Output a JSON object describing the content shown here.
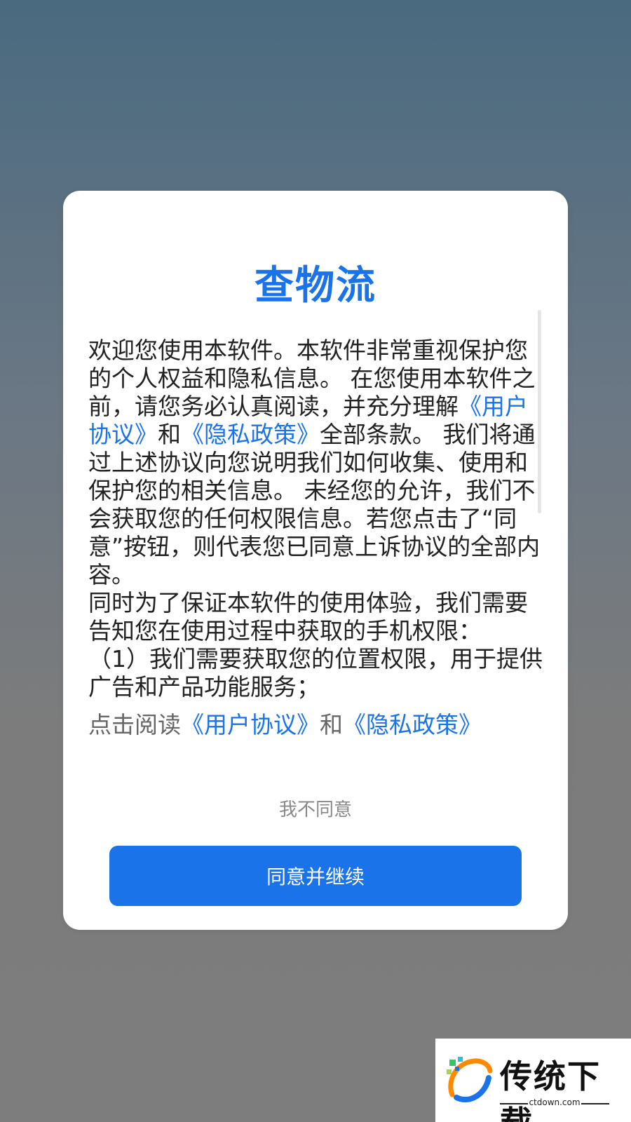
{
  "dialog": {
    "title": "查物流",
    "body": [
      {
        "text": "欢迎您使用本软件。本软件非常重视保护您的个人权益和隐私信息。 在您使用本软件之前，请您务必认真阅读，并充分理解",
        "link": false
      },
      {
        "text": "《用户协议》",
        "link": true
      },
      {
        "text": "和",
        "link": false
      },
      {
        "text": "《隐私政策》",
        "link": true
      },
      {
        "text": "全部条款。 我们将通过上述协议向您说明我们如何收集、使用和保护您的相关信息。 未经您的允许，我们不会获取您的任何权限信息。若您点击了“同意”按钮，则代表您已同意上诉协议的全部内容。",
        "link": false
      },
      {
        "text": "\n 同时为了保证本软件的使用体验，我们需要告知您在使用过程中获取的手机权限：\n（1）我们需要获取您的位置权限，用于提供广告和产品功能服务；",
        "link": false
      }
    ],
    "read_prefix": "点击阅读",
    "user_agreement_link": "《用户协议》",
    "and_text": "和",
    "privacy_policy_link": "《隐私政策》",
    "disagree_label": "我不同意",
    "agree_label": "同意并继续"
  },
  "watermark": {
    "brand": "传统下载",
    "domain": "ctdown.com"
  }
}
